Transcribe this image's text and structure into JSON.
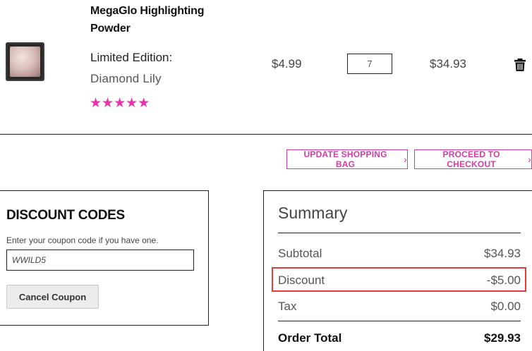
{
  "product": {
    "name": "MegaGlo Highlighting Powder",
    "edition_label": "Limited Edition:",
    "shade": "Diamond Lily",
    "rating_stars": "★★★★★",
    "rating_value": 5,
    "unit_price": "$4.99",
    "quantity": "7",
    "row_total": "$34.93"
  },
  "actions": {
    "update_label": "UPDATE SHOPPING BAG",
    "checkout_label": "PROCEED TO CHECKOUT"
  },
  "discount": {
    "title": "DISCOUNT CODES",
    "hint": "Enter your coupon code if you have one.",
    "coupon_value": "WWILD5",
    "cancel_label": "Cancel Coupon"
  },
  "summary": {
    "title": "Summary",
    "subtotal_label": "Subtotal",
    "subtotal_value": "$34.93",
    "discount_label": "Discount",
    "discount_value": "-$5.00",
    "tax_label": "Tax",
    "tax_value": "$0.00",
    "total_label": "Order Total",
    "total_value": "$29.93"
  },
  "colors": {
    "accent": "#d63aa5",
    "stars": "#e535ad",
    "highlight": "#e23c3c"
  },
  "icons": {
    "delete": "trash-icon",
    "chevron": "chevron-right-icon"
  }
}
